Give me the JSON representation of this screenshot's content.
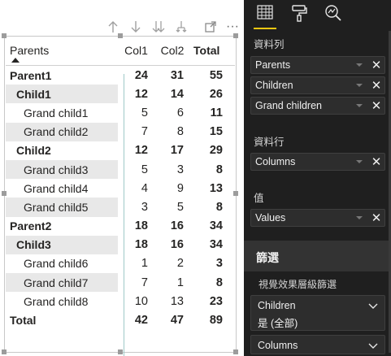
{
  "visual_header": {
    "icons": [
      "arrow-up-icon",
      "arrow-down-icon",
      "double-arrow-down-icon",
      "expand-hierarchy-icon",
      "focus-mode-icon",
      "more-options-icon"
    ],
    "more_label": "···"
  },
  "matrix": {
    "headers": {
      "rows": "Parents",
      "col1": "Col1",
      "col2": "Col2",
      "total": "Total"
    },
    "rows": [
      {
        "label": "Parent1",
        "level": 0,
        "col1": "24",
        "col2": "31",
        "total": "55",
        "alt": false,
        "bold": true
      },
      {
        "label": "Child1",
        "level": 1,
        "col1": "12",
        "col2": "14",
        "total": "26",
        "alt": true,
        "bold": true
      },
      {
        "label": "Grand child1",
        "level": 2,
        "col1": "5",
        "col2": "6",
        "total": "11",
        "alt": false,
        "bold": false
      },
      {
        "label": "Grand child2",
        "level": 2,
        "col1": "7",
        "col2": "8",
        "total": "15",
        "alt": true,
        "bold": false
      },
      {
        "label": "Child2",
        "level": 1,
        "col1": "12",
        "col2": "17",
        "total": "29",
        "alt": false,
        "bold": true
      },
      {
        "label": "Grand child3",
        "level": 2,
        "col1": "5",
        "col2": "3",
        "total": "8",
        "alt": true,
        "bold": false
      },
      {
        "label": "Grand child4",
        "level": 2,
        "col1": "4",
        "col2": "9",
        "total": "13",
        "alt": false,
        "bold": false
      },
      {
        "label": "Grand child5",
        "level": 2,
        "col1": "3",
        "col2": "5",
        "total": "8",
        "alt": true,
        "bold": false
      },
      {
        "label": "Parent2",
        "level": 0,
        "col1": "18",
        "col2": "16",
        "total": "34",
        "alt": false,
        "bold": true
      },
      {
        "label": "Child3",
        "level": 1,
        "col1": "18",
        "col2": "16",
        "total": "34",
        "alt": true,
        "bold": true
      },
      {
        "label": "Grand child6",
        "level": 2,
        "col1": "1",
        "col2": "2",
        "total": "3",
        "alt": false,
        "bold": false
      },
      {
        "label": "Grand child7",
        "level": 2,
        "col1": "7",
        "col2": "1",
        "total": "8",
        "alt": true,
        "bold": false
      },
      {
        "label": "Grand child8",
        "level": 2,
        "col1": "10",
        "col2": "13",
        "total": "23",
        "alt": false,
        "bold": false
      }
    ],
    "grand_total": {
      "label": "Total",
      "col1": "42",
      "col2": "47",
      "total": "89"
    }
  },
  "panel": {
    "tabs": [
      "fields-icon",
      "format-paint-icon",
      "analytics-icon"
    ],
    "accent": "#f2c811",
    "rows_label": "資料列",
    "rows_fields": [
      "Parents",
      "Children",
      "Grand children"
    ],
    "columns_label": "資料行",
    "columns_fields": [
      "Columns"
    ],
    "values_label": "值",
    "values_fields": [
      "Values"
    ],
    "filters_title": "篩選",
    "filters_sub": "視覺效果層級篩選",
    "filter_cards": [
      {
        "field": "Children",
        "state": "是 (全部)"
      },
      {
        "field": "Columns",
        "state": ""
      }
    ]
  }
}
